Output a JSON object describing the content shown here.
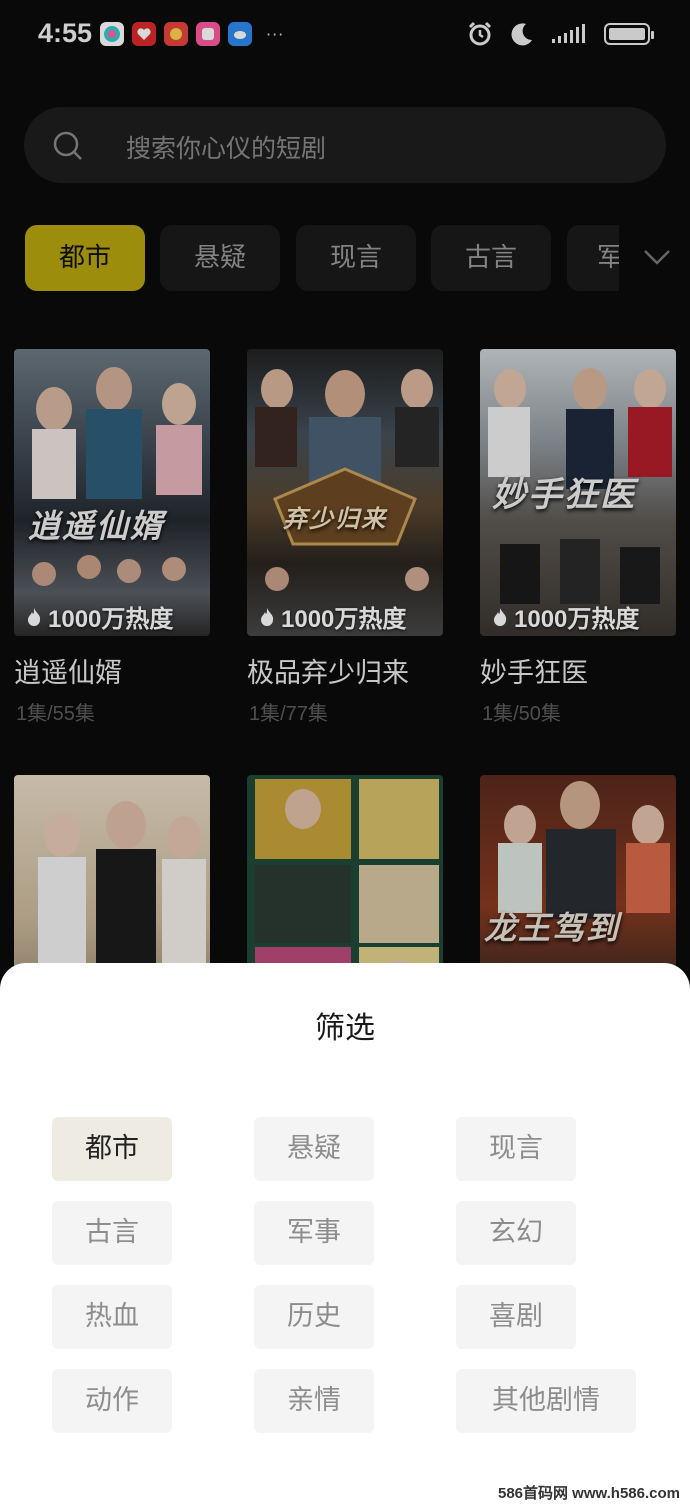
{
  "status_bar": {
    "time": "4:55",
    "more": "···"
  },
  "search": {
    "placeholder": "搜索你心仪的短剧"
  },
  "categories": [
    "都市",
    "悬疑",
    "现言",
    "古言",
    "军"
  ],
  "dramas": [
    {
      "title": "逍遥仙婿",
      "episodes": "1集/55集",
      "heat": "1000万热度",
      "poster_text": "逍遥仙婿"
    },
    {
      "title": "极品弃少归来",
      "episodes": "1集/77集",
      "heat": "1000万热度",
      "poster_text": "弃少归来"
    },
    {
      "title": "妙手狂医",
      "episodes": "1集/50集",
      "heat": "1000万热度",
      "poster_text": "妙手狂医"
    },
    {
      "title": "",
      "episodes": "",
      "heat": "",
      "poster_text": ""
    },
    {
      "title": "",
      "episodes": "",
      "heat": "",
      "poster_text": ""
    },
    {
      "title": "",
      "episodes": "",
      "heat": "",
      "poster_text": "龙王驾到"
    }
  ],
  "filter_sheet": {
    "title": "筛选",
    "options": [
      "都市",
      "悬疑",
      "现言",
      "古言",
      "军事",
      "玄幻",
      "热血",
      "历史",
      "喜剧",
      "动作",
      "亲情",
      "其他剧情"
    ],
    "selected": "都市"
  },
  "watermark": "586首码网 www.h586.com",
  "colors": {
    "accent": "#b9a60f",
    "background": "#0b0b0b",
    "sheet": "#ffffff"
  }
}
